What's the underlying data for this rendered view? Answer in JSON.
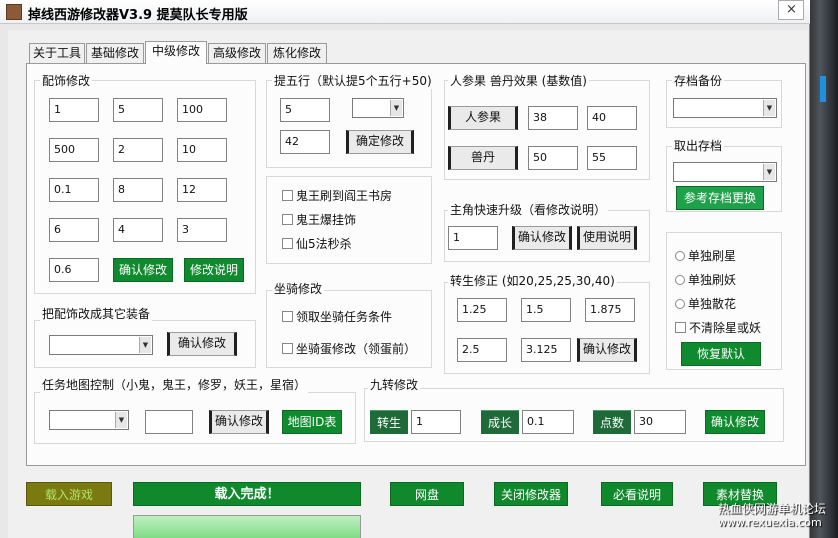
{
  "title": "掉线西游修改器V3.9   提莫队长专用版",
  "close_icon": "×",
  "tabs": [
    {
      "label": "关于工具"
    },
    {
      "label": "基础修改"
    },
    {
      "label": "中级修改"
    },
    {
      "label": "高级修改"
    },
    {
      "label": "炼化修改"
    }
  ],
  "accessory": {
    "title": "配饰修改",
    "fields": [
      "1",
      "5",
      "100",
      "500",
      "2",
      "10",
      "0.1",
      "8",
      "12",
      "6",
      "4",
      "3",
      "0.6"
    ],
    "confirm": "确认修改",
    "help": "修改说明"
  },
  "convert": {
    "title": "把配饰改成其它装备",
    "combo": "",
    "confirm": "确认修改"
  },
  "mapctrl": {
    "title": "任务地图控制（小鬼，鬼王，修罗，妖王，星宿）",
    "combo": "",
    "field": "",
    "confirm": "确认修改",
    "mapid": "地图ID表"
  },
  "wuxing": {
    "title": "提五行（默认提5个五行+50)",
    "field1": "5",
    "combo": "",
    "field2": "42",
    "confirm": "确定修改"
  },
  "ghost": {
    "opt1": "鬼王刷到阎王书房",
    "opt2": "鬼王爆挂饰",
    "opt3": "仙5法秒杀"
  },
  "mount": {
    "title": "坐骑修改",
    "opt1": "领取坐骑任务条件",
    "opt2": "坐骑蛋修改（领蛋前）"
  },
  "ginseng": {
    "title": "人参果 兽丹效果 (基数值)",
    "btn1": "人参果",
    "v1a": "38",
    "v1b": "40",
    "btn2": "兽丹",
    "v2a": "50",
    "v2b": "55"
  },
  "levelup": {
    "title": "主角快速升级（看修改说明）",
    "field": "1",
    "confirm": "确认修改",
    "help": "使用说明"
  },
  "rebirth": {
    "title": "转生修正 (如20,25,25,30,40)",
    "fields": [
      "1.25",
      "1.5",
      "1.875",
      "2.5",
      "3.125"
    ],
    "confirm": "确认修改"
  },
  "nine": {
    "title": "九转修改",
    "l1": "转生",
    "v1": "1",
    "l2": "成长",
    "v2": "0.1",
    "l3": "点数",
    "v3": "30",
    "confirm": "确认修改"
  },
  "save": {
    "title": "存档备份",
    "combo": ""
  },
  "load": {
    "title": "取出存档",
    "combo": "",
    "ref": "参考存档更换"
  },
  "options": {
    "r1": "单独刷星",
    "r2": "单独刷妖",
    "r3": "单独散花",
    "c1": "不清除星或妖",
    "restore": "恢复默认"
  },
  "bottom": {
    "load_game": "载入游戏",
    "status": "载入完成！",
    "progress": 1.0,
    "netdisk": "网盘",
    "close": "关闭修改器",
    "must": "必看说明",
    "material": "素材替换"
  },
  "watermark": {
    "line1": "热血侠网游单机论坛",
    "line2": "www.rexuexia.com"
  }
}
